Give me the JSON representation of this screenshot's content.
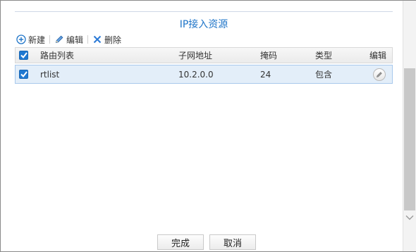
{
  "section_title": "IP接入资源",
  "toolbar": {
    "new_label": "新建",
    "edit_label": "编辑",
    "delete_label": "删除"
  },
  "table": {
    "headers": {
      "route_list": "路由列表",
      "subnet": "子网地址",
      "mask": "掩码",
      "type": "类型",
      "edit": "编辑"
    },
    "header_checked": true,
    "rows": [
      {
        "checked": true,
        "route_list": "rtlist",
        "subnet": "10.2.0.0",
        "mask": "24",
        "type": "包含"
      }
    ]
  },
  "footer": {
    "confirm_label": "完成",
    "cancel_label": "取消"
  },
  "colors": {
    "accent": "#1e74c8",
    "checkbox": "#1f78d1",
    "selected_row": "#e3eef9",
    "delete_icon": "#2b7ad6"
  },
  "icons": {
    "new": "plus-circle-icon",
    "edit": "pencil-icon",
    "delete": "x-icon",
    "row_edit": "pencil-circle-icon",
    "scroll_down": "chevron-down-icon"
  }
}
